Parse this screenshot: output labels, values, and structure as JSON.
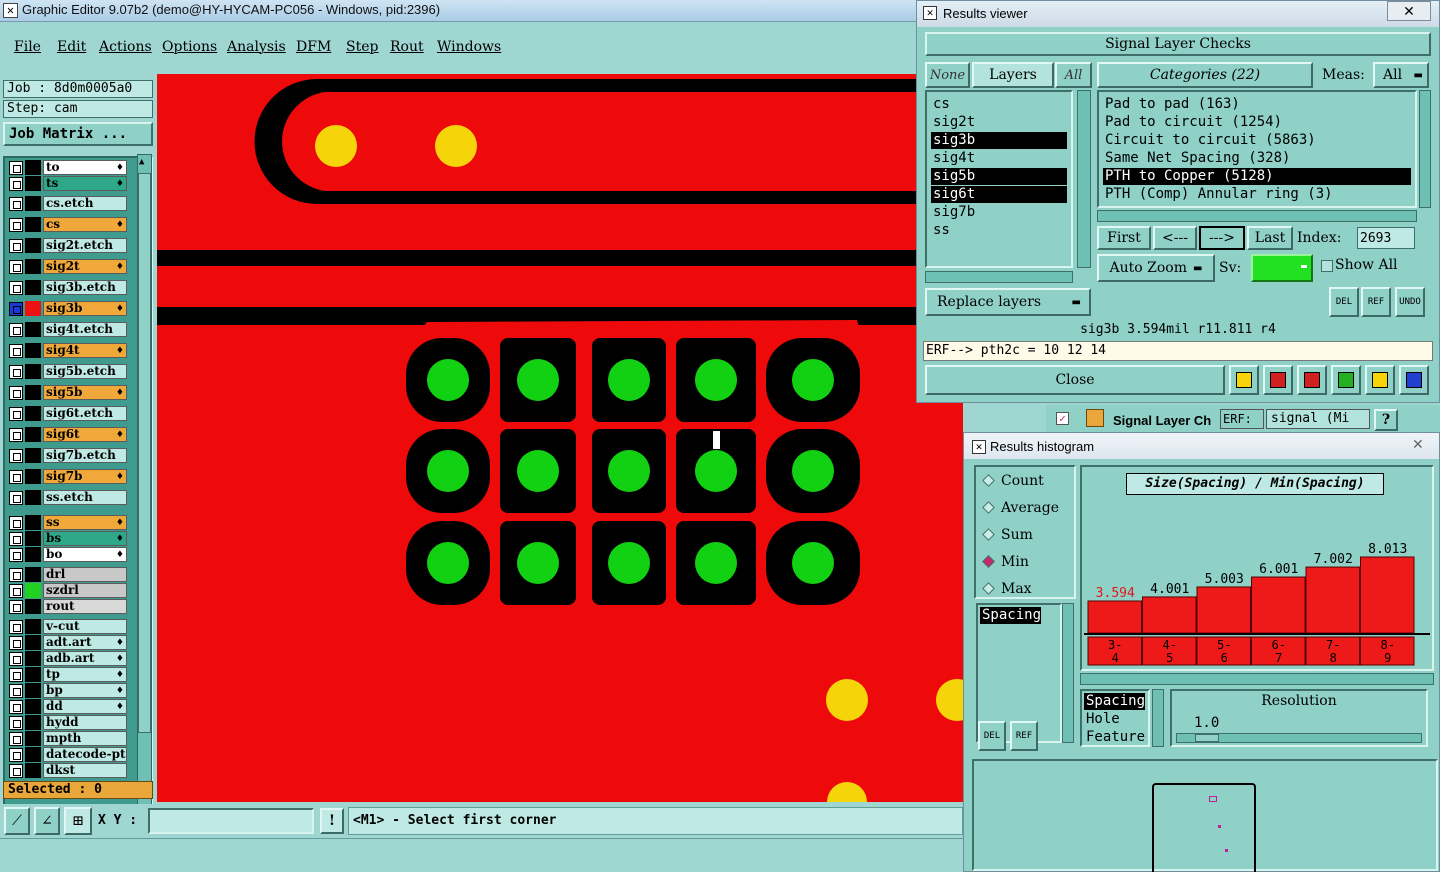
{
  "titlebar": {
    "title": "Graphic Editor 9.07b2 (demo@HY-HYCAM-PC056 - Windows, pid:2396)"
  },
  "menu": [
    "File",
    "Edit",
    "Actions",
    "Options",
    "Analysis",
    "DFM",
    "Step",
    "Rout",
    "Windows"
  ],
  "job": {
    "job": "Job : 8d0m0005a0",
    "step": "Step: cam",
    "matrix_button": "Job Matrix ..."
  },
  "layers": [
    {
      "name": "to",
      "color": "#ffffff",
      "flame": true
    },
    {
      "name": "ts",
      "color": "#2fa88a",
      "flame": true
    },
    {
      "name": "cs.etch",
      "color": "#bfe9e4",
      "flame": false
    },
    {
      "name": "cs",
      "color": "#f0a83a",
      "flame": true
    },
    {
      "name": "sig2t.etch",
      "color": "#bfe9e4",
      "flame": false
    },
    {
      "name": "sig2t",
      "color": "#f0a83a",
      "flame": true
    },
    {
      "name": "sig3b.etch",
      "color": "#bfe9e4",
      "flame": false
    },
    {
      "name": "sig3b",
      "color": "#f0a83a",
      "flame": true
    },
    {
      "name": "sig4t.etch",
      "color": "#bfe9e4",
      "flame": false
    },
    {
      "name": "sig4t",
      "color": "#f0a83a",
      "flame": true
    },
    {
      "name": "sig5b.etch",
      "color": "#bfe9e4",
      "flame": false
    },
    {
      "name": "sig5b",
      "color": "#f0a83a",
      "flame": true
    },
    {
      "name": "sig6t.etch",
      "color": "#bfe9e4",
      "flame": false
    },
    {
      "name": "sig6t",
      "color": "#f0a83a",
      "flame": true
    },
    {
      "name": "sig7b.etch",
      "color": "#bfe9e4",
      "flame": false
    },
    {
      "name": "sig7b",
      "color": "#f0a83a",
      "flame": true
    },
    {
      "name": "ss.etch",
      "color": "#bfe9e4",
      "flame": false
    },
    {
      "name": "ss",
      "color": "#f0a83a",
      "flame": true
    },
    {
      "name": "bs",
      "color": "#2fa88a",
      "flame": true
    },
    {
      "name": "bo",
      "color": "#ffffff",
      "flame": true
    },
    {
      "name": "drl",
      "color": "#c8c8c8",
      "flame": false
    },
    {
      "name": "szdrl",
      "color": "#c8c8c8",
      "flame": false
    },
    {
      "name": "rout",
      "color": "#d8d8d8",
      "flame": false
    },
    {
      "name": "v-cut",
      "color": "#bfe9e4",
      "flame": false
    },
    {
      "name": "adt.art",
      "color": "#bfe9e4",
      "flame": true
    },
    {
      "name": "adb.art",
      "color": "#bfe9e4",
      "flame": true
    },
    {
      "name": "tp",
      "color": "#bfe9e4",
      "flame": true
    },
    {
      "name": "bp",
      "color": "#bfe9e4",
      "flame": true
    },
    {
      "name": "dd",
      "color": "#bfe9e4",
      "flame": true
    },
    {
      "name": "hydd",
      "color": "#bfe9e4",
      "flame": false
    },
    {
      "name": "mpth",
      "color": "#bfe9e4",
      "flame": false
    },
    {
      "name": "datecode-pt",
      "color": "#bfe9e4",
      "flame": false
    },
    {
      "name": "dkst",
      "color": "#bfe9e4",
      "flame": false
    }
  ],
  "selected": "Selected : 0",
  "bottom": {
    "xy_label": "X Y :",
    "xy_value": "",
    "prompt": "<M1> - Select first corner"
  },
  "results_viewer": {
    "title": "Results viewer",
    "close_x": "✕",
    "header": "Signal Layer Checks",
    "none_btn": "None",
    "layers_btn": "Layers",
    "all_btn": "All",
    "layer_list": [
      {
        "name": "cs",
        "sel": false
      },
      {
        "name": "sig2t",
        "sel": false
      },
      {
        "name": "sig3b",
        "sel": true
      },
      {
        "name": "sig4t",
        "sel": false
      },
      {
        "name": "sig5b",
        "sel": true
      },
      {
        "name": "sig6t",
        "sel": true
      },
      {
        "name": "sig7b",
        "sel": false
      },
      {
        "name": "ss",
        "sel": false
      }
    ],
    "categories_btn": "Categories (22)",
    "meas_label": "Meas:",
    "meas_value": "All",
    "categories": [
      {
        "name": "Pad to pad (163)",
        "sel": false
      },
      {
        "name": "Pad to circuit (1254)",
        "sel": false
      },
      {
        "name": "Circuit to circuit (5863)",
        "sel": false
      },
      {
        "name": "Same Net Spacing (328)",
        "sel": false
      },
      {
        "name": "PTH to Copper (5128)",
        "sel": true
      },
      {
        "name": "PTH (Comp) Annular ring (3)",
        "sel": false
      }
    ],
    "first_btn": "First",
    "prev_btn": "<---",
    "next_btn": "--->",
    "last_btn": "Last",
    "index_label": "Index:",
    "index_value": "2693",
    "autozoom": "Auto Zoom",
    "sv_label": "Sv:",
    "show_all": "Show All",
    "replace_layers": "Replace layers",
    "del_label": "DEL",
    "ref_label": "REF",
    "undo_label": "UNDO",
    "status": "sig3b 3.594mil  r11.811  r4",
    "erf_line": "ERF--> pth2c = 10 12 14",
    "close_btn": "Close",
    "colors": {
      "sv": "#22e022"
    }
  },
  "behind_strip": {
    "text": "Signal Layer Ch",
    "erf": "ERF:",
    "erf_value": "signal (Mi",
    "help": "?"
  },
  "histogram": {
    "title": "Results histogram",
    "close_x": "✕",
    "modes": [
      {
        "label": "Count",
        "on": false
      },
      {
        "label": "Average",
        "on": false
      },
      {
        "label": "Sum",
        "on": false
      },
      {
        "label": "Min",
        "on": true
      },
      {
        "label": "Max",
        "on": false
      }
    ],
    "list_item": "Spacing",
    "del_label": "DEL",
    "ref_label": "REF",
    "chart_title": "Size(Spacing) / Min(Spacing)",
    "chart_data": {
      "type": "bar",
      "title": "Size(Spacing) / Min(Spacing)",
      "categories": [
        "3-4",
        "4-5",
        "5-6",
        "6-7",
        "7-8",
        "8-9"
      ],
      "values": [
        3.594,
        4.001,
        5.003,
        6.001,
        7.002,
        8.013
      ],
      "value_labels": [
        "3.594",
        "4.001",
        "5.003",
        "6.001",
        "7.002",
        "8.013"
      ],
      "highlight_index": 0,
      "colors": {
        "bar": "#ee1a1a",
        "highlight_label": "#e01818"
      }
    },
    "bin_lines": [
      [
        "3-",
        "4"
      ],
      [
        "4-",
        "5"
      ],
      [
        "5-",
        "6"
      ],
      [
        "6-",
        "7"
      ],
      [
        "7-",
        "8"
      ],
      [
        "8-",
        "9"
      ]
    ],
    "size_options": [
      "Spacing",
      "Hole",
      "Feature"
    ],
    "resolution_label": "Resolution",
    "resolution_value": "1.0"
  }
}
